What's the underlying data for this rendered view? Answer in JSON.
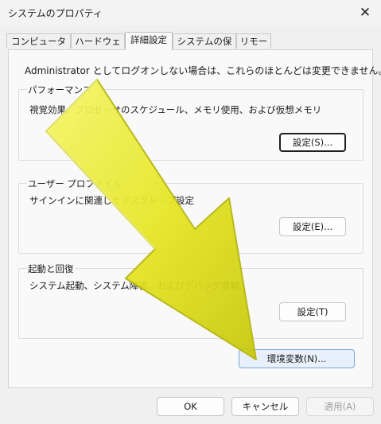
{
  "window": {
    "title": "システムのプロパティ",
    "close_icon": "close-icon"
  },
  "tabs": [
    {
      "label": "コンピューター名"
    },
    {
      "label": "ハードウェア"
    },
    {
      "label": "詳細設定",
      "selected": true
    },
    {
      "label": "システムの保護"
    },
    {
      "label": "リモート"
    }
  ],
  "admin_note": "Administrator としてログオンしない場合は、これらのほとんどは変更できません。",
  "performance": {
    "title": "パフォーマンス",
    "description": "視覚効果、プロセッサのスケジュール、メモリ使用、および仮想メモリ",
    "button": "設定(S)..."
  },
  "user_profiles": {
    "title": "ユーザー プロファイル",
    "description": "サインインに関連したデスクトップ設定",
    "button": "設定(E)..."
  },
  "startup_recovery": {
    "title": "起動と回復",
    "description": "システム起動、システム障害、およびデバッグ情報",
    "button": "設定(T)"
  },
  "env_button": "環境変数(N)...",
  "footer": {
    "ok": "OK",
    "cancel": "キャンセル",
    "apply": "適用(A)"
  },
  "overlay": {
    "icon": "arrow-annotation-icon",
    "color": "#e5e521"
  }
}
